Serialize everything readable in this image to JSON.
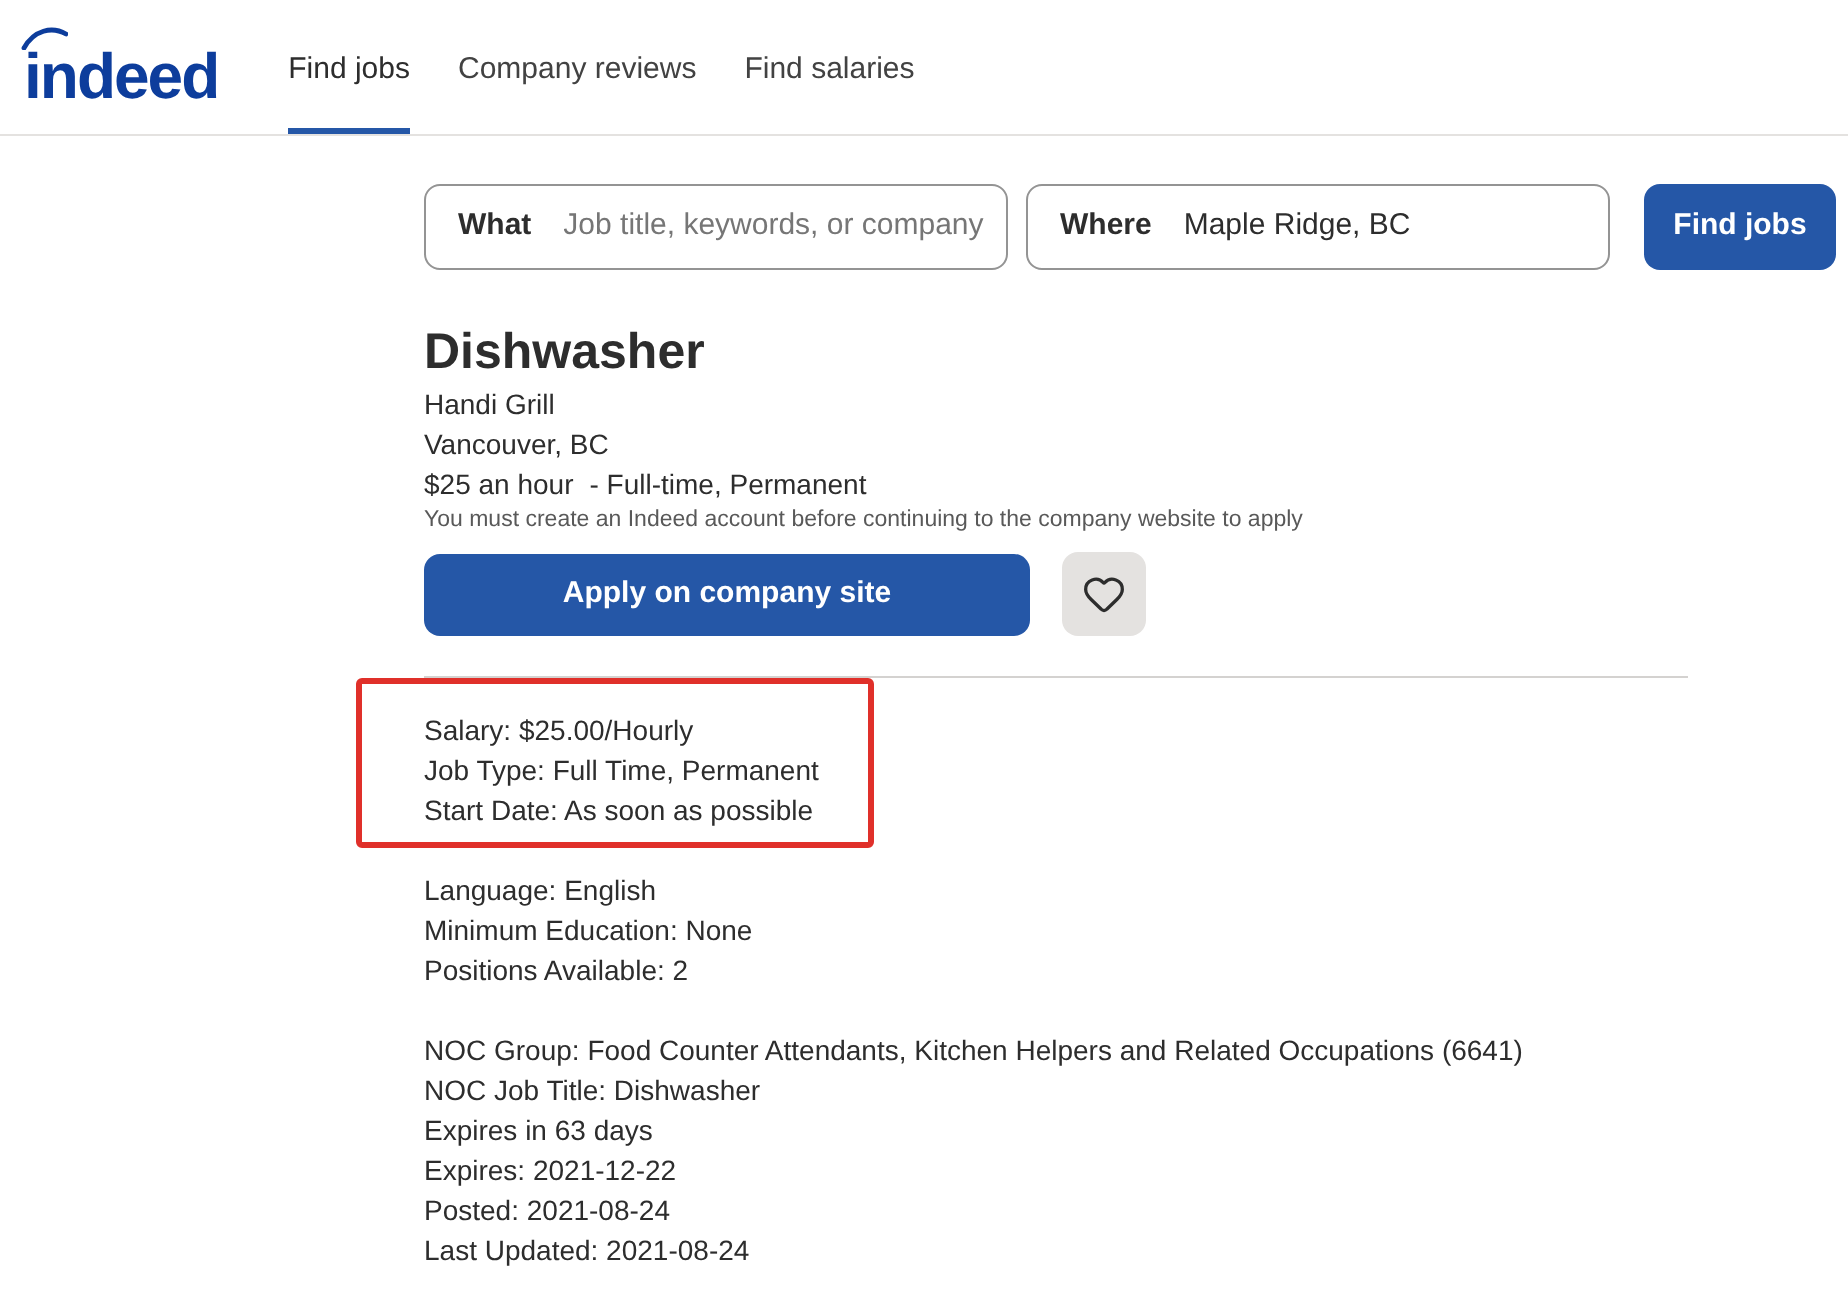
{
  "header": {
    "logo": "indeed",
    "nav": [
      {
        "label": "Find jobs",
        "selected": true
      },
      {
        "label": "Company reviews",
        "selected": false
      },
      {
        "label": "Find salaries",
        "selected": false
      }
    ]
  },
  "search": {
    "what": {
      "label": "What",
      "placeholder": "Job title, keywords, or company"
    },
    "where": {
      "label": "Where",
      "value": "Maple Ridge, BC"
    },
    "button": "Find jobs"
  },
  "job": {
    "title": "Dishwasher",
    "company": "Handi Grill",
    "location": "Vancouver, BC",
    "pay": "$25 an hour",
    "job_type": "- Full-time, Permanent",
    "notice": "You must create an Indeed account before continuing to the company website to apply",
    "apply_button": "Apply on company site",
    "saved": false
  },
  "details": [
    {
      "highlighted": true,
      "lines": [
        "Salary: $25.00/Hourly",
        "Job Type: Full Time, Permanent",
        "Start Date: As soon as possible"
      ]
    },
    {
      "highlighted": false,
      "lines": [
        "Language: English",
        "Minimum Education: None",
        "Positions Available: 2"
      ]
    },
    {
      "highlighted": false,
      "lines": [
        "NOC Group: Food Counter Attendants, Kitchen Helpers and Related Occupations (6641)",
        "NOC Job Title: Dishwasher",
        "Expires in 63 days",
        "Expires: 2021-12-22",
        "Posted: 2021-08-24",
        "Last Updated: 2021-08-24"
      ]
    }
  ]
}
